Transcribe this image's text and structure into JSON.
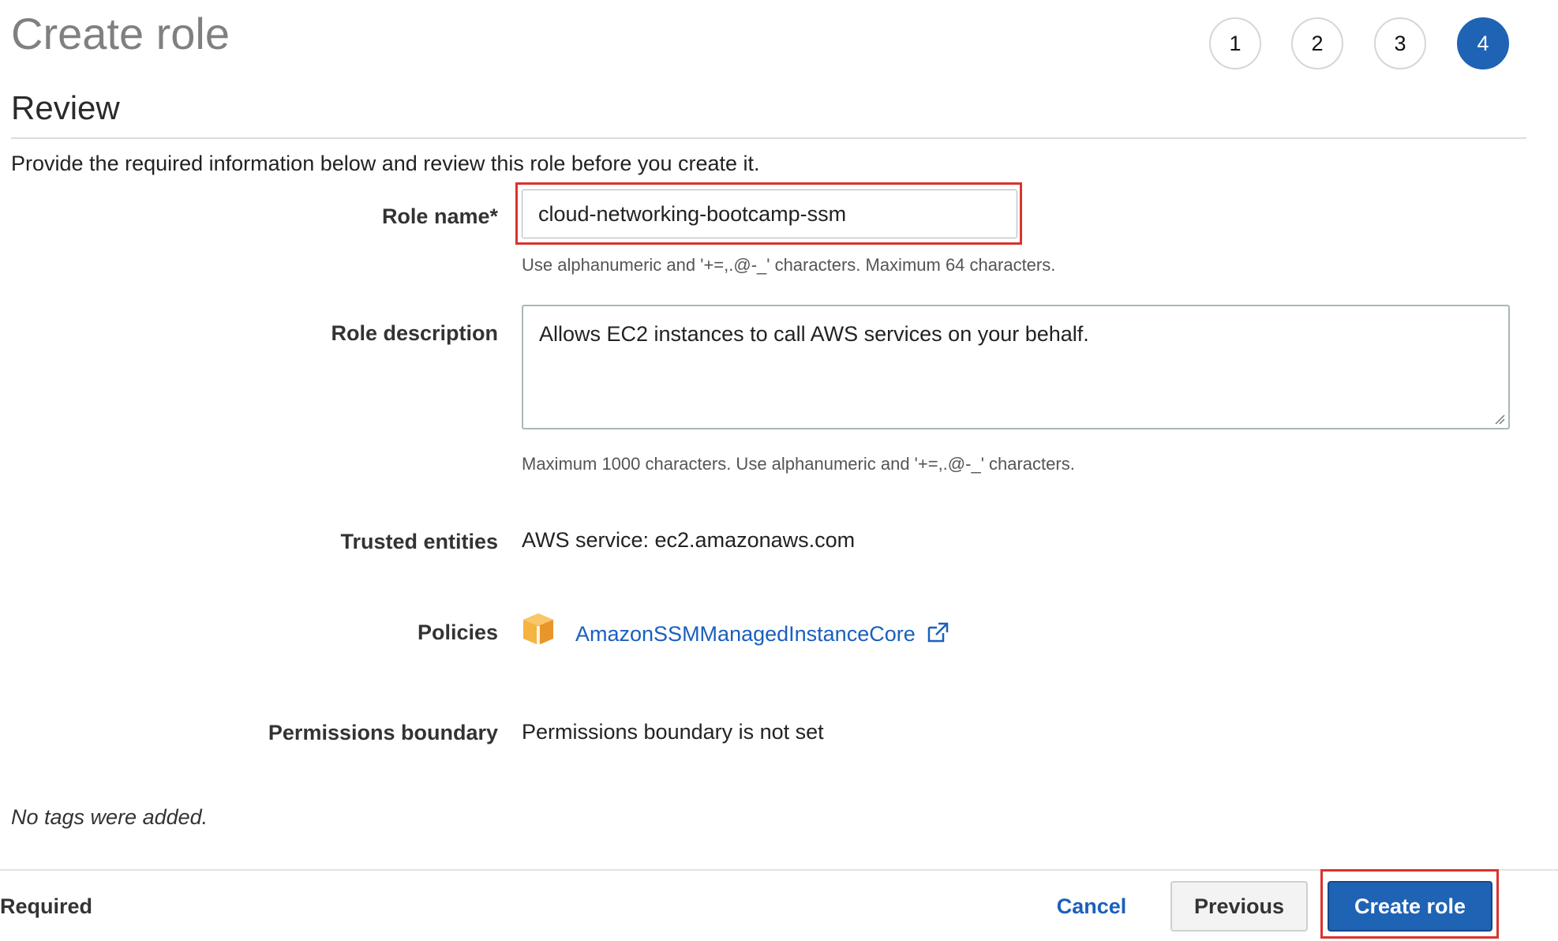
{
  "header": {
    "title": "Create role",
    "steps": [
      "1",
      "2",
      "3",
      "4"
    ],
    "active_step": "4"
  },
  "review": {
    "heading": "Review",
    "intro": "Provide the required information below and review this role before you create it."
  },
  "form": {
    "role_name": {
      "label": "Role name*",
      "value": "cloud-networking-bootcamp-ssm",
      "hint": "Use alphanumeric and '+=,.@-_' characters. Maximum 64 characters."
    },
    "role_description": {
      "label": "Role description",
      "value": "Allows EC2 instances to call AWS services on your behalf.",
      "hint": "Maximum 1000 characters. Use alphanumeric and '+=,.@-_' characters."
    },
    "trusted_entities": {
      "label": "Trusted entities",
      "value": "AWS service: ec2.amazonaws.com"
    },
    "policies": {
      "label": "Policies",
      "items": [
        {
          "name": "AmazonSSMManagedInstanceCore",
          "icon": "policy-box-icon"
        }
      ]
    },
    "permissions_boundary": {
      "label": "Permissions boundary",
      "value": "Permissions boundary is not set"
    },
    "tags_note": "No tags were added."
  },
  "footer": {
    "required_label": "Required",
    "cancel_label": "Cancel",
    "previous_label": "Previous",
    "create_label": "Create role"
  },
  "colors": {
    "primary": "#1f63b5",
    "link": "#1a5fbf",
    "highlight": "#d9332e",
    "policy_icon": "#f0a030"
  }
}
